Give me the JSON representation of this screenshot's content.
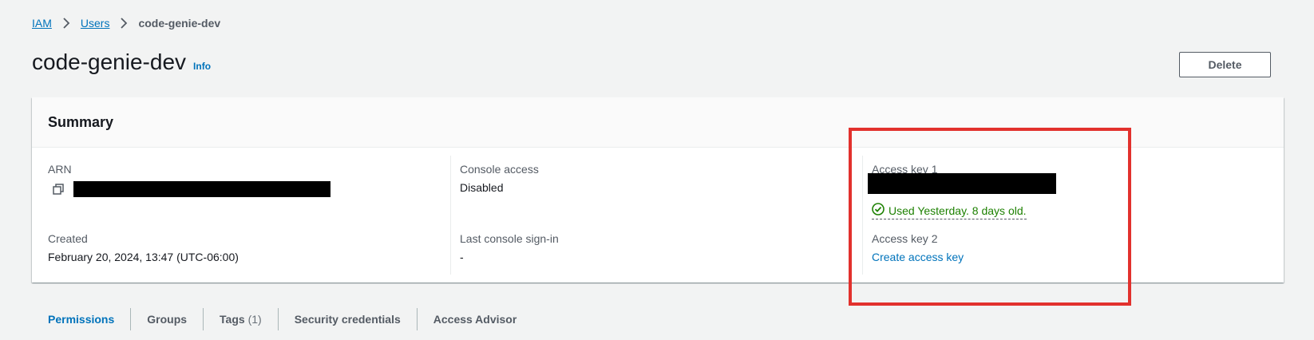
{
  "breadcrumb": {
    "items": [
      "IAM",
      "Users"
    ],
    "current": "code-genie-dev"
  },
  "header": {
    "title": "code-genie-dev",
    "info_label": "Info",
    "delete_label": "Delete"
  },
  "summary": {
    "title": "Summary",
    "arn": {
      "label": "ARN"
    },
    "created": {
      "label": "Created",
      "value": "February 20, 2024, 13:47 (UTC-06:00)"
    },
    "console_access": {
      "label": "Console access",
      "value": "Disabled"
    },
    "last_console_signin": {
      "label": "Last console sign-in",
      "value": "-"
    },
    "access_key_1": {
      "label": "Access key 1",
      "status": "Used Yesterday. 8 days old."
    },
    "access_key_2": {
      "label": "Access key 2",
      "action": "Create access key"
    }
  },
  "tabs": [
    {
      "label": "Permissions",
      "active": true
    },
    {
      "label": "Groups"
    },
    {
      "label": "Tags",
      "count": "(1)"
    },
    {
      "label": "Security credentials"
    },
    {
      "label": "Access Advisor"
    }
  ],
  "colors": {
    "link": "#0073bb",
    "success": "#1d8102",
    "highlight": "#e2312d"
  }
}
